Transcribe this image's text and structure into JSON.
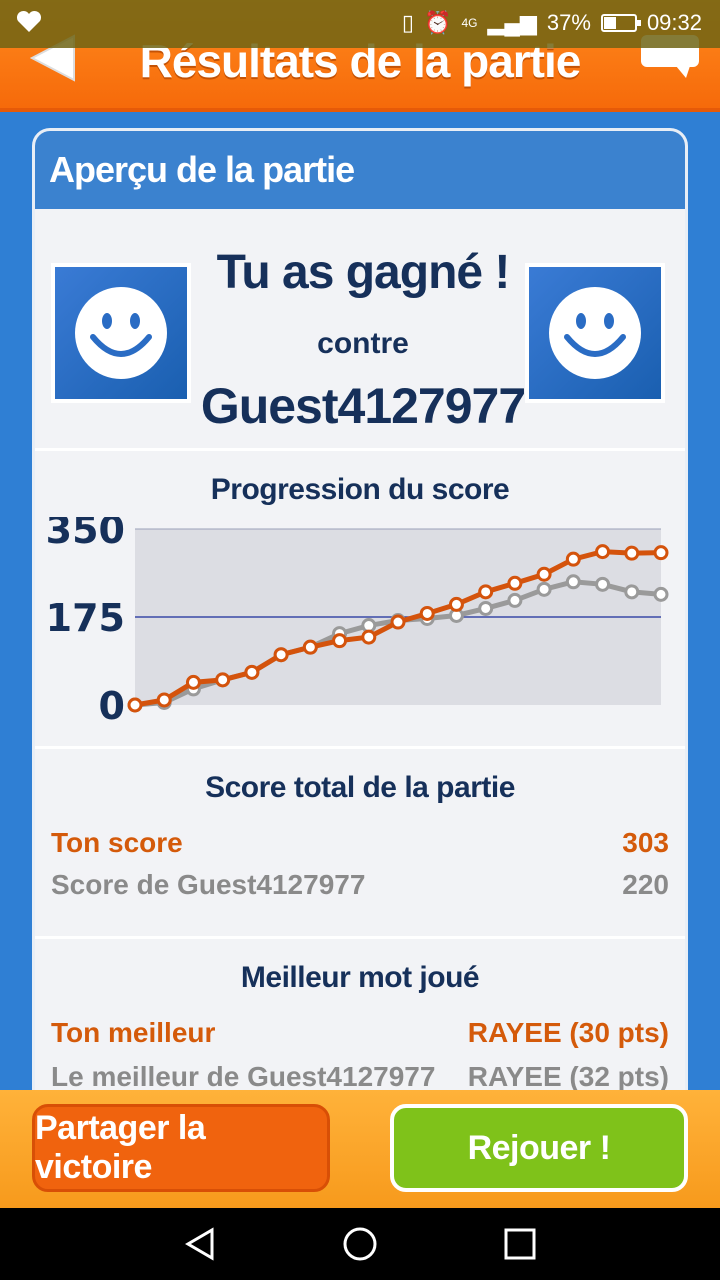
{
  "status_bar": {
    "battery": "37%",
    "time": "09:32",
    "network": "4G"
  },
  "header": {
    "title": "Résultats de la partie"
  },
  "card": {
    "title": "Aperçu de la partie",
    "result": "Tu as gagné !",
    "versus": "contre",
    "opponent": "Guest4127977"
  },
  "chart_section": {
    "title": "Progression du score"
  },
  "chart_data": {
    "type": "line",
    "ylim": [
      0,
      350
    ],
    "yticks": [
      "350",
      "175",
      "0"
    ],
    "x": [
      1,
      2,
      3,
      4,
      5,
      6,
      7,
      8,
      9,
      10,
      11,
      12,
      13,
      14,
      15,
      16,
      17,
      18,
      19
    ],
    "series": [
      {
        "color": "#d4530c",
        "values": [
          0,
          10,
          45,
          50,
          65,
          100,
          115,
          128,
          135,
          165,
          182,
          200,
          225,
          242,
          260,
          290,
          305,
          302,
          303
        ]
      },
      {
        "color": "#9a9a9a",
        "values": [
          0,
          5,
          32,
          50,
          65,
          100,
          115,
          142,
          158,
          168,
          172,
          178,
          192,
          208,
          230,
          245,
          240,
          225,
          220
        ]
      }
    ],
    "grid": true
  },
  "score_section": {
    "title": "Score total de la partie",
    "your_label": "Ton score",
    "your_value": "303",
    "opp_label": "Score de Guest4127977",
    "opp_value": "220"
  },
  "best_word_section": {
    "title": "Meilleur mot joué",
    "your_label": "Ton meilleur",
    "your_value": "RAYEE (30 pts)",
    "opp_label": "Le meilleur de Guest4127977",
    "opp_value": "RAYEE (32 pts)"
  },
  "buttons": {
    "share": "Partager la victoire",
    "replay": "Rejouer !"
  },
  "colors": {
    "accent_orange": "#f66a0a",
    "card_header_blue": "#3b82cf",
    "replay_green": "#7fc21a",
    "text_navy": "#16305a"
  }
}
